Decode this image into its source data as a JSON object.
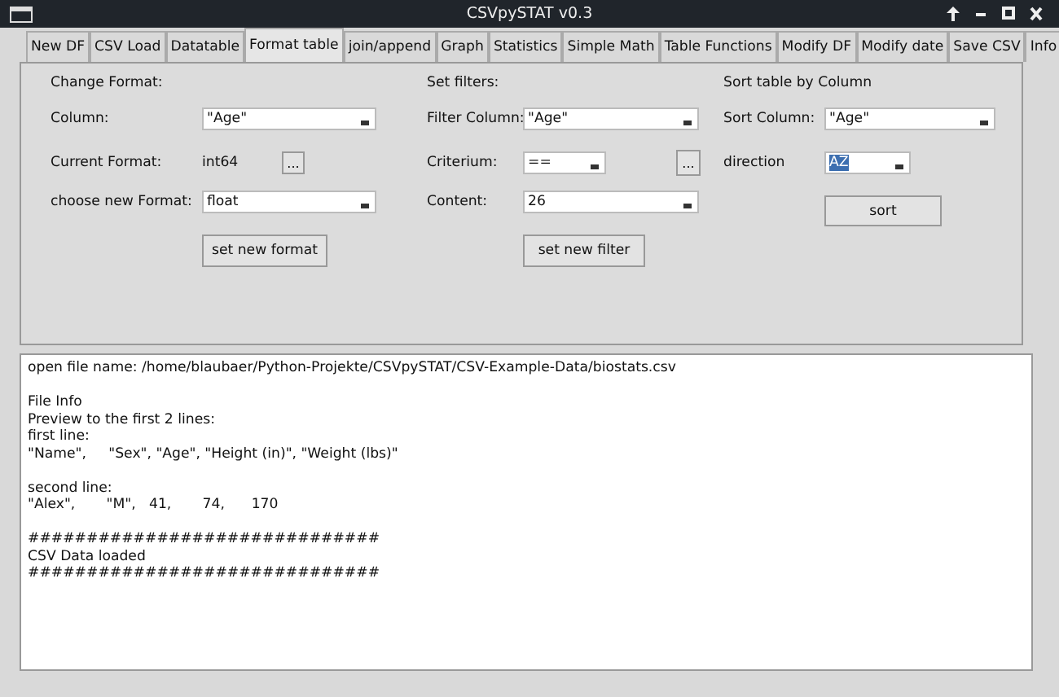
{
  "window": {
    "title": "CSVpySTAT v0.3"
  },
  "tabs": [
    {
      "label": "New DF",
      "selected": false
    },
    {
      "label": "CSV Load",
      "selected": false
    },
    {
      "label": "Datatable",
      "selected": false
    },
    {
      "label": "Format table",
      "selected": true
    },
    {
      "label": "join/append",
      "selected": false
    },
    {
      "label": "Graph",
      "selected": false
    },
    {
      "label": "Statistics",
      "selected": false
    },
    {
      "label": "Simple Math",
      "selected": false
    },
    {
      "label": "Table Functions",
      "selected": false
    },
    {
      "label": "Modify DF",
      "selected": false
    },
    {
      "label": "Modify date",
      "selected": false
    },
    {
      "label": "Save CSV",
      "selected": false
    },
    {
      "label": "Info",
      "selected": false
    }
  ],
  "format": {
    "heading": "Change Format:",
    "column": {
      "label": "Column:",
      "value": "\"Age\""
    },
    "current": {
      "label": "Current Format:",
      "value": "int64",
      "button": "..."
    },
    "new_format": {
      "label": "choose new Format:",
      "value": "float"
    },
    "button": "set new format"
  },
  "filters": {
    "heading": "Set filters:",
    "column": {
      "label": "Filter Column:",
      "value": "\"Age\""
    },
    "criterium": {
      "label": "Criterium:",
      "value": "==",
      "button": "..."
    },
    "content": {
      "label": "Content:",
      "value": "26"
    },
    "button": "set new filter"
  },
  "sort": {
    "heading": "Sort table by Column",
    "column": {
      "label": "Sort Column:",
      "value": "\"Age\""
    },
    "direction": {
      "label": "direction",
      "value": "AZ",
      "text_selected": true
    },
    "button": "sort"
  },
  "output": {
    "paragraphs": [
      {
        "lines": [
          "open file name: /home/blaubaer/Python-Projekte/CSVpySTAT/CSV-Example-Data/biostats.csv"
        ]
      },
      {
        "lines": [
          "File Info",
          "Preview to the first 2 lines:",
          "first line:",
          "\"Name\",     \"Sex\", \"Age\", \"Height (in)\", \"Weight (lbs)\""
        ]
      },
      {
        "lines": [
          "second line:",
          "\"Alex\",       \"M\",   41,       74,      170"
        ]
      },
      {
        "lines": [
          "##############################",
          "CSV Data loaded",
          "##############################"
        ]
      }
    ]
  }
}
